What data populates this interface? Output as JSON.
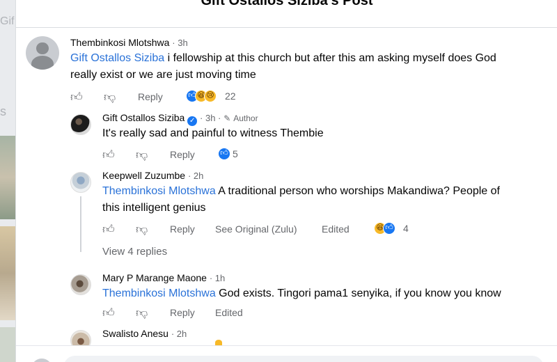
{
  "background": {
    "page_fragment_text": "Gif",
    "side_letter": "s"
  },
  "dialog": {
    "title": "Gift Ostallos Siziba's Post"
  },
  "comments": [
    {
      "author": "Thembinkosi Mlotshwa",
      "time": "· 3h",
      "mention": "Gift Ostallos Siziba",
      "text_line1": " i fellowship at this church but after this am asking myself does God",
      "text_line2": "really exist or we are just moving time",
      "actions": {
        "reply": "Reply"
      },
      "reactions": {
        "icons": [
          "like-icon",
          "haha-icon",
          "sad-icon"
        ],
        "count": "22"
      }
    },
    {
      "author": "Gift Ostallos Siziba",
      "time": "· 3h ·",
      "author_badge": "Author",
      "text": "It's really sad and painful to witness Thembie",
      "actions": {
        "reply": "Reply"
      },
      "reactions": {
        "icons": [
          "like-icon"
        ],
        "count": "5"
      }
    },
    {
      "author": "Keepwell Zuzumbe",
      "time": "· 2h",
      "mention": "Thembinkosi Mlotshwa",
      "text_line1": " A traditional person who worships Makandiwa? People of",
      "text_line2": "this intelligent genius",
      "actions": {
        "reply": "Reply",
        "see_original": "See Original (Zulu)",
        "edited": "Edited"
      },
      "reactions": {
        "icons": [
          "haha-icon",
          "like-icon"
        ],
        "count": "4"
      },
      "view_replies": "View 4 replies"
    },
    {
      "author": "Mary P Marange Maone",
      "time": "· 1h",
      "mention": "Thembinkosi Mlotshwa",
      "text": " God exists. Tingori pama1 senyika, if you know you know",
      "actions": {
        "reply": "Reply",
        "edited": "Edited"
      }
    },
    {
      "author": "Swalisto Anesu",
      "time": "· 2h"
    }
  ],
  "colors": {
    "mention": "#2a72d8",
    "meta_gray": "#65676b",
    "like_blue": "#1877f2",
    "emoji_yellow": "#f7b928"
  }
}
